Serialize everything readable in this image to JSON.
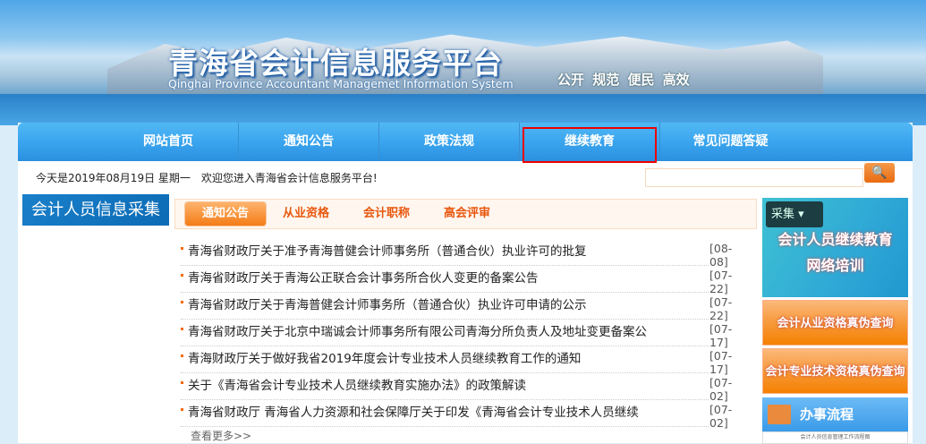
{
  "header": {
    "title": "青海省会计信息服务平台",
    "subtitle": "Qinghai Province Accountant Managemet Information System",
    "slogan": "公开 规范 便民 高效"
  },
  "nav": [
    "网站首页",
    "通知公告",
    "政策法规",
    "继续教育",
    "常见问题答疑"
  ],
  "date_text": "今天是2019年08月19日 星期一　欢迎您进入青海省会计信息服务平台!",
  "search": {
    "value": "",
    "placeholder": ""
  },
  "left_panel": "会计人员信息采集",
  "tabs": [
    "通知公告",
    "从业资格",
    "会计职称",
    "高会评审"
  ],
  "news": [
    {
      "title": "青海省财政厅关于准予青海普健会计师事务所（普通合伙）执业许可的批复",
      "date": "[08-08]"
    },
    {
      "title": "青海省财政厅关于青海公正联合会计事务所合伙人变更的备案公告",
      "date": "[07-22]"
    },
    {
      "title": "青海省财政厅关于青海普健会计师事务所（普通合伙）执业许可申请的公示",
      "date": "[07-22]"
    },
    {
      "title": "青海省财政厅关于北京中瑞诚会计师事务所有限公司青海分所负责人及地址变更备案公",
      "date": "[07-17]"
    },
    {
      "title": "青海财政厅关于做好我省2019年度会计专业技术人员继续教育工作的通知",
      "date": "[07-17]"
    },
    {
      "title": "关于《青海省会计专业技术人员继续教育实施办法》的政策解读",
      "date": "[07-02]"
    },
    {
      "title": "青海省财政厅 青海省人力资源和社会保障厅关于印发《青海省会计专业技术人员继续",
      "date": "[07-02]"
    }
  ],
  "more": "查看更多>>",
  "right": {
    "collect": "采集",
    "ad_line1": "会计人员继续教育",
    "ad_line2": "网络培训",
    "btn1": "会计从业资格真伪查询",
    "btn2": "会计专业技术资格真伪查询",
    "flow": "办事流程",
    "flow_sub": "会计人员信息管理工作流程图"
  }
}
